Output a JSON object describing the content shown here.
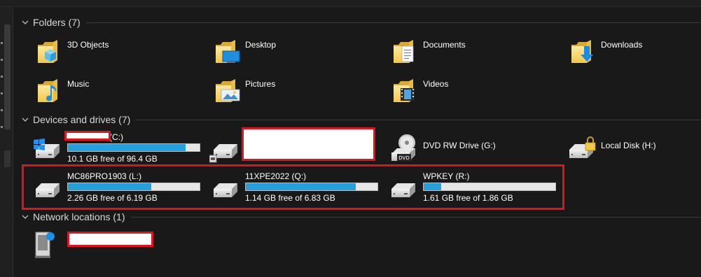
{
  "groups": {
    "folders": "Folders (7)",
    "devices": "Devices and drives (7)",
    "network": "Network locations (1)"
  },
  "folders": [
    {
      "label": "3D Objects",
      "icon": "3d-objects-folder-icon"
    },
    {
      "label": "Desktop",
      "icon": "desktop-folder-icon"
    },
    {
      "label": "Documents",
      "icon": "documents-folder-icon"
    },
    {
      "label": "Downloads",
      "icon": "downloads-folder-icon"
    },
    {
      "label": "Music",
      "icon": "music-folder-icon"
    },
    {
      "label": "Pictures",
      "icon": "pictures-folder-icon"
    },
    {
      "label": "Videos",
      "icon": "videos-folder-icon"
    }
  ],
  "drives": [
    {
      "name": "(C:)",
      "free_text": "10.1 GB free of 96.4 GB",
      "used_fraction": 0.895,
      "icon": "windows-drive-icon"
    },
    {
      "name": "",
      "free_text": "",
      "icon": "drive-icon"
    },
    {
      "name": "DVD RW Drive (G:)",
      "icon": "dvd-drive-icon"
    },
    {
      "name": "Local Disk (H:)",
      "icon": "locked-drive-icon"
    },
    {
      "name": "MC86PRO1903 (L:)",
      "free_text": "2.26 GB free of 6.19 GB",
      "used_fraction": 0.635,
      "icon": "drive-icon"
    },
    {
      "name": "11XPE2022 (Q:)",
      "free_text": "1.14 GB free of 6.83 GB",
      "used_fraction": 0.833,
      "icon": "drive-icon"
    },
    {
      "name": "WPKEY (R:)",
      "free_text": "1.61 GB free of 1.86 GB",
      "used_fraction": 0.134,
      "icon": "drive-icon"
    }
  ],
  "network": [
    {
      "name": "",
      "icon": "network-location-icon"
    }
  ],
  "colors": {
    "background": "#191919",
    "accent_bar": "#26a0da",
    "highlight": "#e0141e"
  }
}
